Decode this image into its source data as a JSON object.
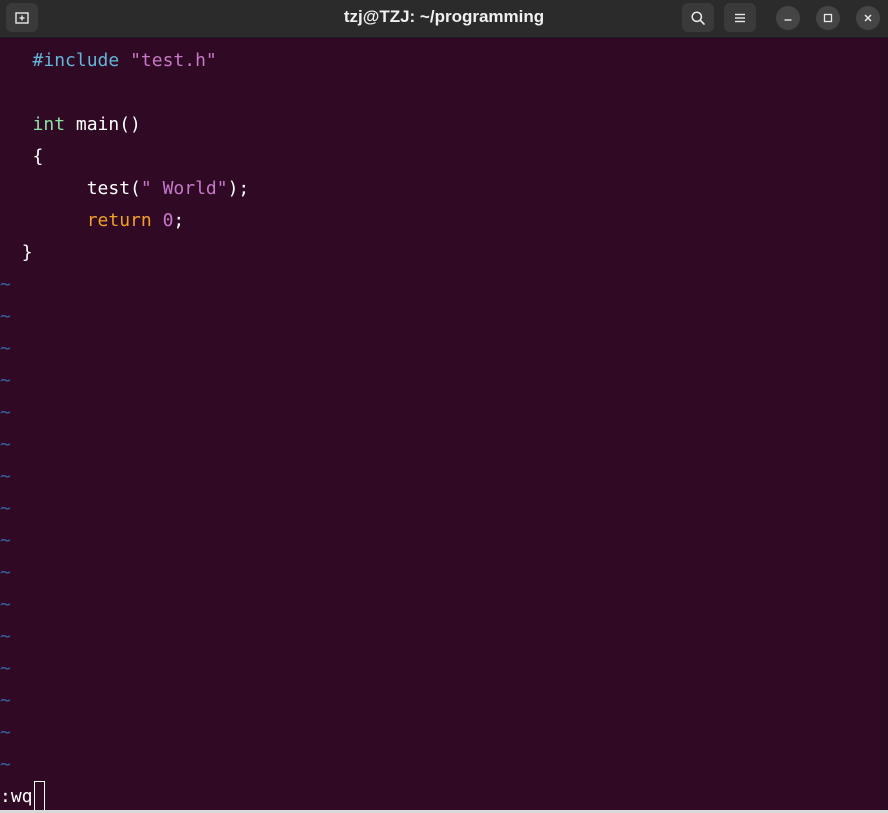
{
  "window": {
    "title": "tzj@TZJ: ~/programming"
  },
  "icons": {
    "new_tab": "new-tab-icon",
    "search": "search-icon",
    "menu": "hamburger-menu-icon",
    "minimize": "minimize-icon",
    "maximize": "maximize-icon",
    "close": "close-icon"
  },
  "code": {
    "l1_pre": "#include",
    "l1_str": "\"test.h\"",
    "l3_type": "int",
    "l3_rest": "main()",
    "l4": "{",
    "l5_fn": "test(",
    "l5_str": "\" World\"",
    "l5_end": ");",
    "l6_kw": "return",
    "l6_num": "0",
    "l6_end": ";",
    "l7": "}"
  },
  "tilde": "~",
  "command_line": ":wq",
  "colors": {
    "background": "#300a24",
    "preprocessor": "#62b6d8",
    "string": "#c678c8",
    "type": "#8ae2a0",
    "keyword": "#f0a028",
    "tilde": "#3465a4"
  }
}
